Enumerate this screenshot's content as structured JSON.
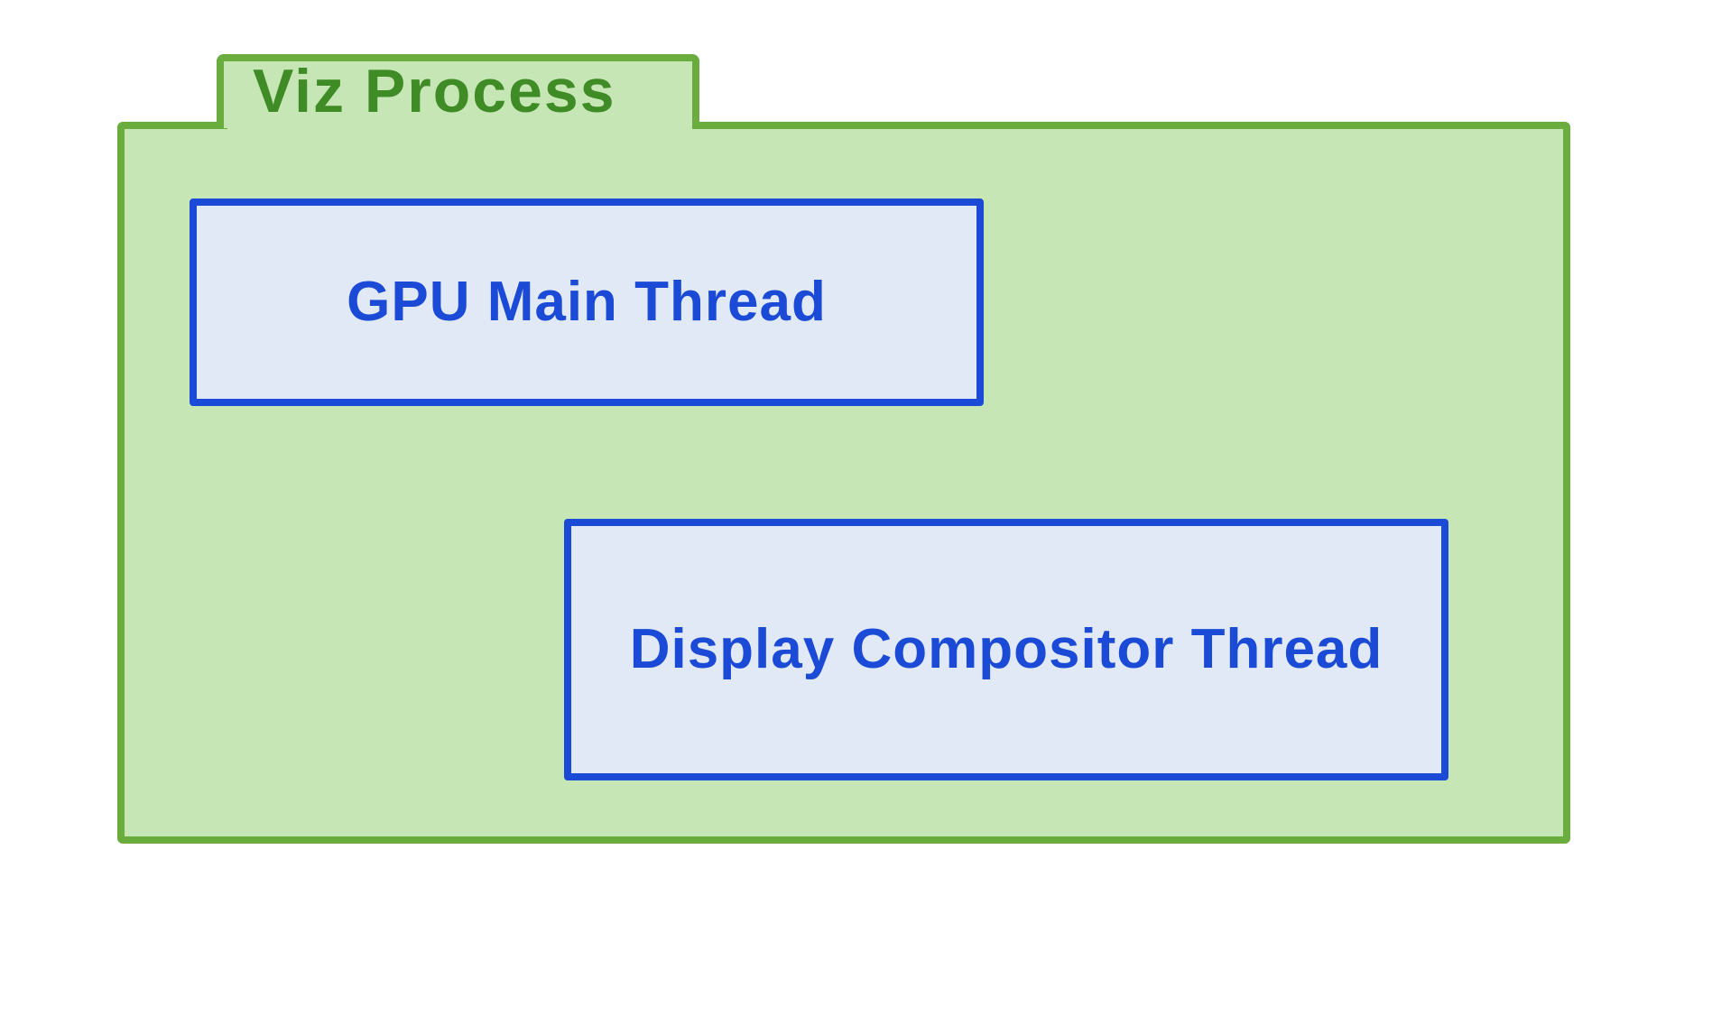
{
  "process": {
    "title": "Viz Process",
    "threads": [
      {
        "label": "GPU Main Thread"
      },
      {
        "label": "Display Compositor Thread"
      }
    ]
  },
  "colors": {
    "process_border": "#6aac3d",
    "process_fill": "#c6e6b5",
    "process_text": "#3f8c26",
    "thread_border": "#1b4bd6",
    "thread_fill": "#e0e9f5",
    "thread_text": "#1b4bd6"
  }
}
